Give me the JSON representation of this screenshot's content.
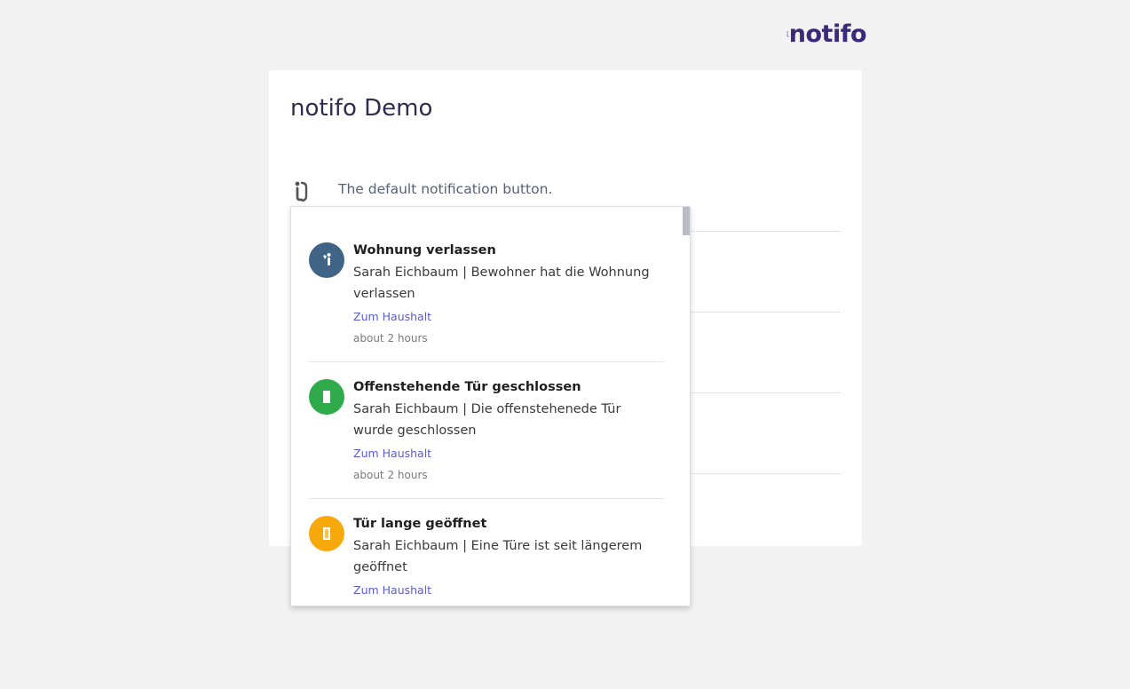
{
  "brand": {
    "logo_text": "notifo"
  },
  "card": {
    "title": "notifo Demo",
    "rows": [
      {
        "description": "The default notification button."
      }
    ]
  },
  "notifications": [
    {
      "title": "Wohnung verlassen",
      "text": "Sarah Eichbaum | Bewohner hat die Wohnung verlassen",
      "link_label": "Zum Haushalt",
      "time": "about 2 hours",
      "icon": "person-leaving-icon",
      "color": "#3f6486"
    },
    {
      "title": "Offenstehende Tür geschlossen",
      "text": "Sarah Eichbaum | Die offenstehenede Tür wurde geschlossen",
      "link_label": "Zum Haushalt",
      "time": "about 2 hours",
      "icon": "door-closed-icon",
      "color": "#2fab4c"
    },
    {
      "title": "Tür lange geöffnet",
      "text": "Sarah Eichbaum | Eine Türe ist seit längerem geöffnet",
      "link_label": "Zum Haushalt",
      "icon": "door-open-icon",
      "color": "#f7a90c"
    }
  ],
  "colors": {
    "background": "#f3f2f2",
    "brand_purple": "#3b2a78",
    "brand_gradient_start": "#c05bd6",
    "brand_gradient_end": "#5b5bd6",
    "link": "#5b5bd6"
  }
}
